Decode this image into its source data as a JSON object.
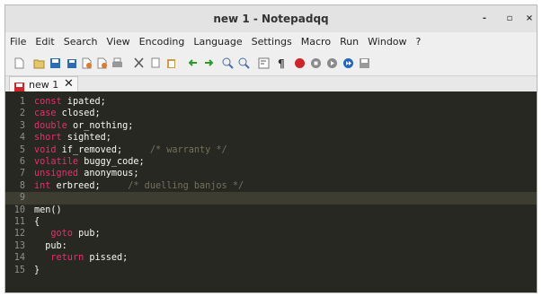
{
  "window": {
    "title": "new 1 - Notepadqq",
    "minimize": "-",
    "maximize": "▫",
    "close": "×"
  },
  "menu": [
    "File",
    "Edit",
    "Search",
    "View",
    "Encoding",
    "Language",
    "Settings",
    "Macro",
    "Run",
    "Window",
    "?"
  ],
  "tab": {
    "label": "new 1",
    "close": "✕"
  },
  "toolbar_icons": [
    "new-file-icon",
    "open-file-icon",
    "save-icon",
    "save-all-icon",
    "close-icon",
    "close-all-icon",
    "print-icon",
    "cut-icon",
    "copy-icon",
    "paste-icon",
    "undo-icon",
    "redo-icon",
    "zoom-in-icon",
    "zoom-out-icon",
    "word-wrap-icon",
    "show-all-chars-icon",
    "record-macro-icon",
    "stop-macro-icon",
    "play-macro-icon",
    "run-macro-multiple-icon",
    "save-macro-icon"
  ],
  "colors": {
    "editor_bg": "#272822",
    "keyword": "#f92672",
    "type": "#66d9ef",
    "text": "#f8f8f2",
    "comment": "#75715e",
    "line_number": "#90908a"
  },
  "lines": [
    {
      "n": "1",
      "parts": [
        {
          "k": "kw",
          "t": "const"
        },
        {
          "k": "tx",
          "t": " ipated;"
        }
      ]
    },
    {
      "n": "2",
      "parts": [
        {
          "k": "kw",
          "t": "case"
        },
        {
          "k": "tx",
          "t": " closed;"
        }
      ]
    },
    {
      "n": "3",
      "parts": [
        {
          "k": "kw",
          "t": "double"
        },
        {
          "k": "tx",
          "t": " or_nothing;"
        }
      ]
    },
    {
      "n": "4",
      "parts": [
        {
          "k": "kw",
          "t": "short"
        },
        {
          "k": "tx",
          "t": " sighted;"
        }
      ]
    },
    {
      "n": "5",
      "parts": [
        {
          "k": "kw",
          "t": "void"
        },
        {
          "k": "tx",
          "t": " if_removed;     "
        },
        {
          "k": "cm",
          "t": "/* warranty */"
        }
      ]
    },
    {
      "n": "6",
      "parts": [
        {
          "k": "kw",
          "t": "volatile"
        },
        {
          "k": "tx",
          "t": " buggy_code;"
        }
      ]
    },
    {
      "n": "7",
      "parts": [
        {
          "k": "kw",
          "t": "unsigned"
        },
        {
          "k": "tx",
          "t": " anonymous;"
        }
      ]
    },
    {
      "n": "8",
      "parts": [
        {
          "k": "kw",
          "t": "int"
        },
        {
          "k": "tx",
          "t": " erbreed;     "
        },
        {
          "k": "cm",
          "t": "/* duelling banjos */"
        }
      ]
    },
    {
      "n": "9",
      "parts": []
    },
    {
      "n": "10",
      "parts": [
        {
          "k": "tx",
          "t": "men()"
        }
      ]
    },
    {
      "n": "11",
      "parts": [
        {
          "k": "tx",
          "t": "{"
        }
      ]
    },
    {
      "n": "12",
      "parts": [
        {
          "k": "tx",
          "t": "   "
        },
        {
          "k": "kw",
          "t": "goto"
        },
        {
          "k": "tx",
          "t": " pub;"
        }
      ]
    },
    {
      "n": "13",
      "parts": [
        {
          "k": "tx",
          "t": "  pub:"
        }
      ]
    },
    {
      "n": "14",
      "parts": [
        {
          "k": "tx",
          "t": "   "
        },
        {
          "k": "kw",
          "t": "return"
        },
        {
          "k": "tx",
          "t": " pissed;"
        }
      ]
    },
    {
      "n": "15",
      "parts": [
        {
          "k": "tx",
          "t": "}"
        }
      ]
    }
  ]
}
